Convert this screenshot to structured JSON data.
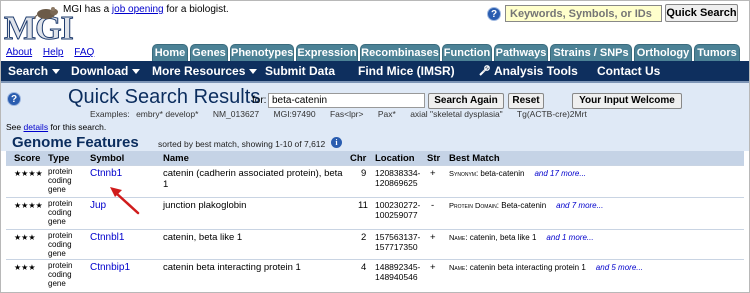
{
  "header": {
    "logo_text": "MGI",
    "tagline_prefix": "MGI has a ",
    "tagline_link": "job opening",
    "tagline_suffix": " for a biologist.",
    "links": [
      "About",
      "Help",
      "FAQ"
    ],
    "help_glyph": "?",
    "search_placeholder": "Keywords, Symbols, or IDs",
    "search_button": "Quick Search"
  },
  "tabs": [
    "Home",
    "Genes",
    "Phenotypes",
    "Expression",
    "Recombinases",
    "Function",
    "Pathways",
    "Strains / SNPs",
    "Orthology",
    "Tumors"
  ],
  "nav": [
    {
      "label": "Search",
      "dropdown": true
    },
    {
      "label": "Download",
      "dropdown": true
    },
    {
      "label": "More Resources",
      "dropdown": true
    },
    {
      "label": "Submit Data",
      "dropdown": false
    },
    {
      "label": "Find Mice (IMSR)",
      "dropdown": false
    },
    {
      "label": "Analysis Tools",
      "dropdown": false,
      "icon": "tools-icon"
    },
    {
      "label": "Contact Us",
      "dropdown": false
    }
  ],
  "quick_search": {
    "title": "Quick Search Results",
    "for_label": "for:",
    "query": "beta-catenin",
    "search_again": "Search Again",
    "reset": "Reset",
    "input_welcome": "Your Input Welcome",
    "examples_label": "Examples:",
    "examples": [
      "embry* develop*",
      "NM_013627",
      "MGI:97490",
      "Fas<lpr>",
      "Pax*",
      "axial \"skeletal dysplasia\"",
      "Tg(ACTB-cre)2Mrt"
    ],
    "details_prefix": "See ",
    "details_link": "details",
    "details_suffix": " for this search."
  },
  "genome_features": {
    "title": "Genome Features",
    "subtitle": "sorted by best match, showing 1-10 of 7,612",
    "info_glyph": "i",
    "columns": [
      "Score",
      "Type",
      "Symbol",
      "Name",
      "Chr",
      "Location",
      "Str",
      "Best Match"
    ],
    "rows": [
      {
        "score": "★★★★",
        "type": "protein coding gene",
        "symbol": "Ctnnb1",
        "name": "catenin (cadherin associated protein), beta 1",
        "chr": "9",
        "location": "120838334-120869625",
        "strand": "+",
        "match_key": "Synonym",
        "match_val": ": beta-catenin",
        "more": "and 17 more..."
      },
      {
        "score": "★★★★",
        "type": "protein coding gene",
        "symbol": "Jup",
        "name": "junction plakoglobin",
        "chr": "11",
        "location": "100230272-100259077",
        "strand": "-",
        "match_key": "Protein Domain",
        "match_val": ": Beta-catenin",
        "more": "and 7 more..."
      },
      {
        "score": "★★★",
        "type": "protein coding gene",
        "symbol": "Ctnnbl1",
        "name": "catenin, beta like 1",
        "chr": "2",
        "location": "157563137-157717350",
        "strand": "+",
        "match_key": "Name",
        "match_val": ": catenin, beta like 1",
        "more": "and 1 more..."
      },
      {
        "score": "★★★",
        "type": "protein coding gene",
        "symbol": "Ctnnbip1",
        "name": "catenin beta interacting protein 1",
        "chr": "4",
        "location": "148892345-148940546",
        "strand": "+",
        "match_key": "Name",
        "match_val": ": catenin beta interacting protein 1",
        "more": "and 5 more..."
      }
    ]
  },
  "colors": {
    "tab": "#4c8296",
    "navbar": "#0e2f5e",
    "band": "#dfe9f6",
    "link": "#0000cc",
    "arrow": "#d01c1c"
  }
}
